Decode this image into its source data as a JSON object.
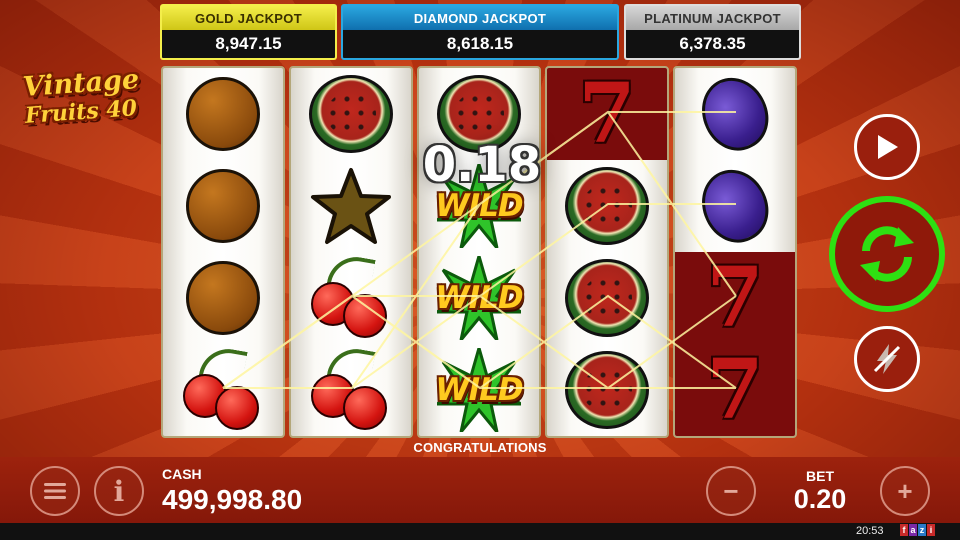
{
  "game": {
    "logo_line1": "Vintage",
    "logo_line2": "Fruits 40",
    "win_amount": "0.18",
    "congrats": "CONGRATULATIONS",
    "wild_label": "WILD"
  },
  "jackpots": {
    "gold": {
      "label": "GOLD JACKPOT",
      "value": "8,947.15",
      "color": "#f4ee4a"
    },
    "diamond": {
      "label": "DIAMOND JACKPOT",
      "value": "8,618.15",
      "color": "#2aa7e0"
    },
    "platinum": {
      "label": "PLATINUM JACKPOT",
      "value": "6,378.35",
      "color": "#d6d6d6"
    }
  },
  "reels": [
    [
      "orange",
      "orange",
      "orange",
      "cherries"
    ],
    [
      "watermelon",
      "star",
      "cherries",
      "cherries"
    ],
    [
      "watermelon",
      "wild",
      "wild",
      "wild"
    ],
    [
      "seven",
      "watermelon",
      "watermelon",
      "watermelon"
    ],
    [
      "plum",
      "plum",
      "seven",
      "seven"
    ]
  ],
  "controls": {
    "play_icon": "play-icon",
    "spin_icon": "refresh-icon",
    "turbo_icon": "lightning-off-icon",
    "menu_icon": "hamburger-icon",
    "info_icon": "info-icon",
    "info_glyph": "i",
    "minus_glyph": "−",
    "plus_glyph": "+",
    "spin_color": "#2ee012"
  },
  "footer": {
    "cash_label": "CASH",
    "cash_value": "499,998.80",
    "bet_label": "BET",
    "bet_value": "0.20",
    "clock": "20:53",
    "brand_letters": [
      "f",
      "a",
      "z",
      "i"
    ]
  }
}
